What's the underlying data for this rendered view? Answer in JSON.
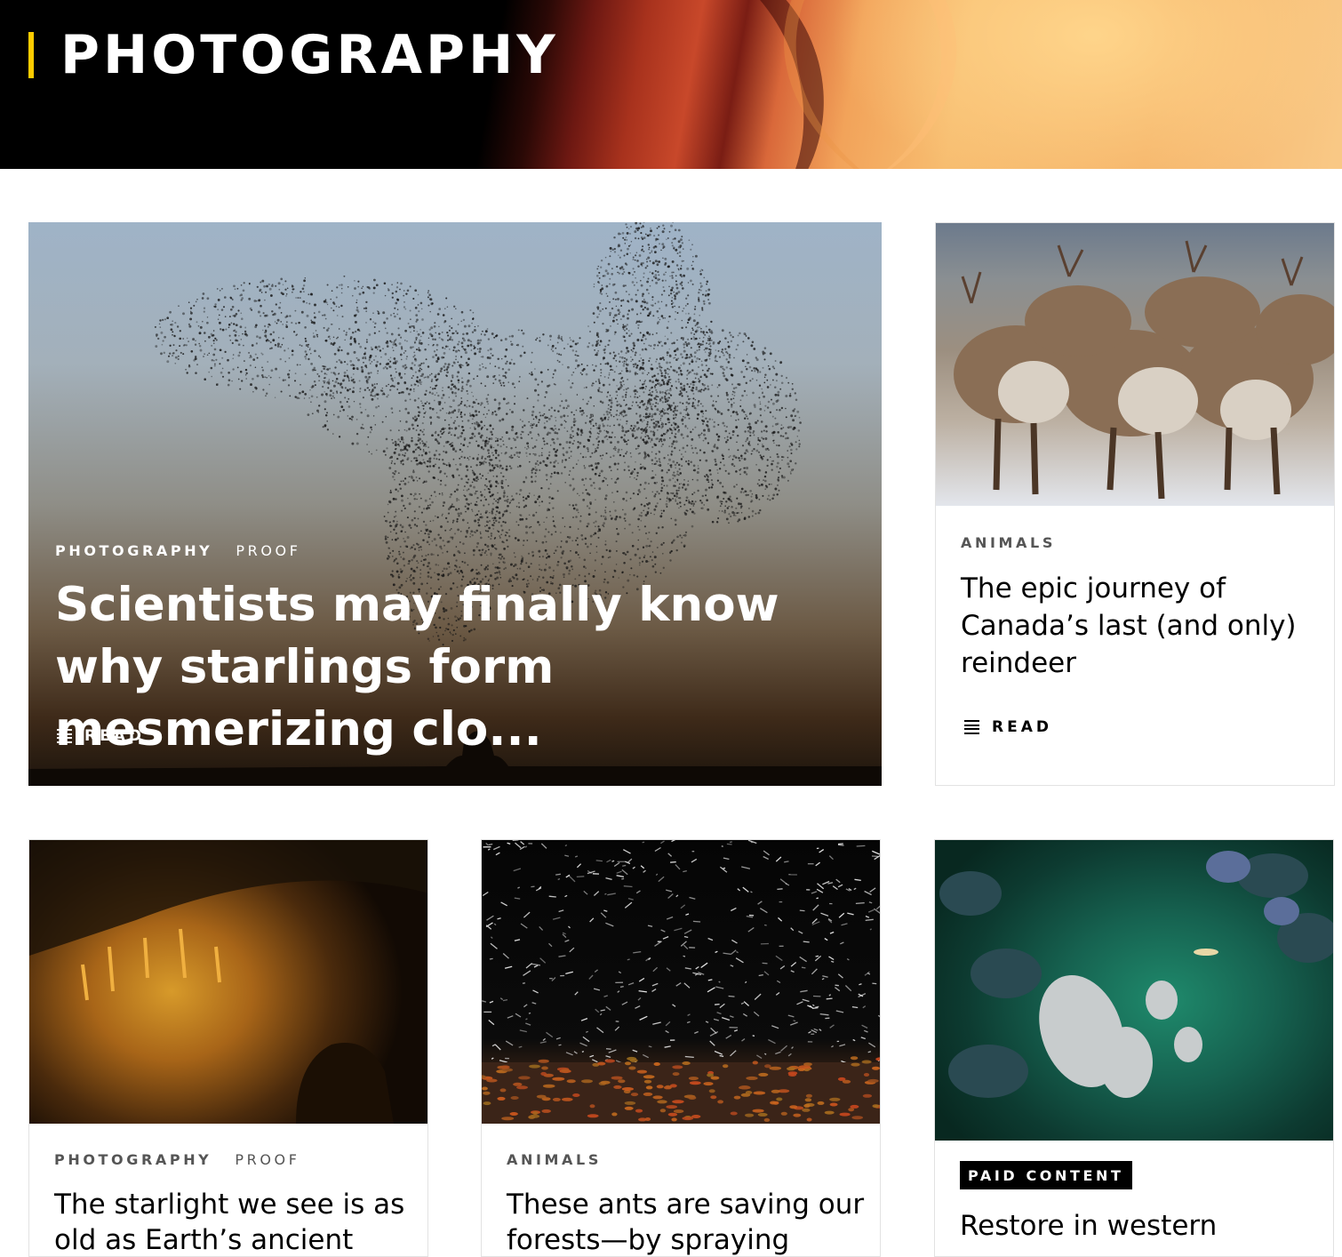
{
  "header": {
    "title": "PHOTOGRAPHY"
  },
  "cards": [
    {
      "tags": [
        "PHOTOGRAPHY",
        "PROOF"
      ],
      "headline": "Scientists may finally know why starlings form mesmerizing clo...",
      "action": "READ",
      "image": "starling-murmuration-photo"
    },
    {
      "tags": [
        "ANIMALS"
      ],
      "headline": "The epic journey of Canada’s last (and only) reindeer",
      "action": "READ",
      "image": "reindeer-herd-photo"
    },
    {
      "tags": [
        "PHOTOGRAPHY",
        "PROOF"
      ],
      "headline": "The starlight we see is as old as Earth’s ancient",
      "image": "cave-photo"
    },
    {
      "tags": [
        "ANIMALS"
      ],
      "headline": "These ants are saving our forests—by spraying",
      "image": "ants-spraying-photo"
    },
    {
      "badge": "PAID CONTENT",
      "headline": "Restore in western",
      "image": "lake-kayak-aerial-photo"
    }
  ],
  "colors": {
    "accent": "#ffcc00",
    "text": "#000000",
    "muted": "#555555"
  }
}
